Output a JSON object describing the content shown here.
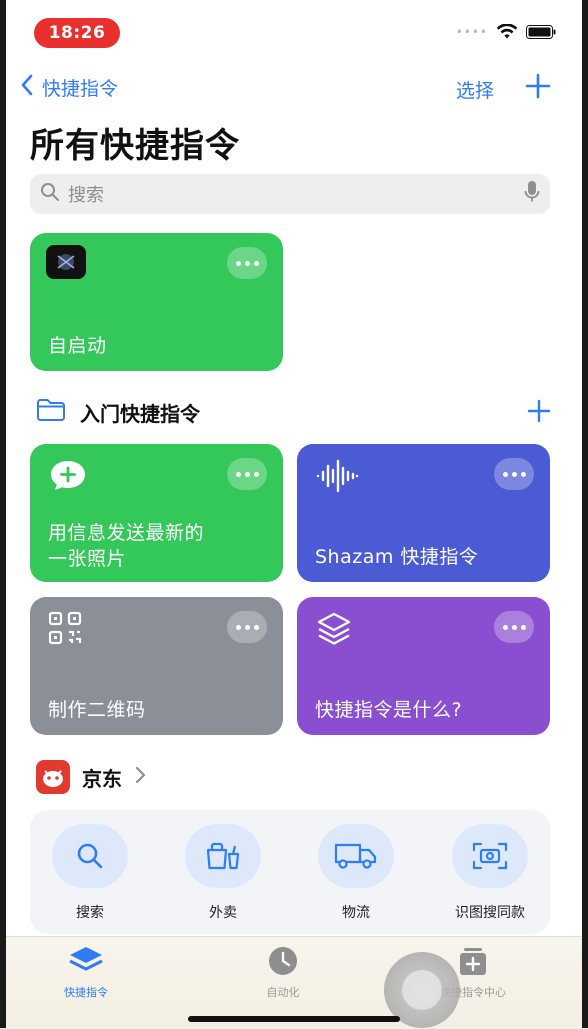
{
  "status": {
    "time": "18:26"
  },
  "nav": {
    "back_label": "快捷指令",
    "select_label": "选择"
  },
  "page": {
    "title": "所有快捷指令"
  },
  "search": {
    "placeholder": "搜索"
  },
  "shortcuts": {
    "top": {
      "label": "自启动"
    },
    "section_title": "入门快捷指令",
    "cards": [
      {
        "label": "用信息发送最新的\n一张照片",
        "icon": "message-plus-icon",
        "color": "#34c759"
      },
      {
        "label": "Shazam 快捷指令",
        "icon": "waveform-icon",
        "color": "#4a5bd3"
      },
      {
        "label": "制作二维码",
        "icon": "qr-code-icon",
        "color": "#8a8f98"
      },
      {
        "label": "快捷指令是什么?",
        "icon": "layers-icon",
        "color": "#8a4fd1"
      }
    ]
  },
  "jd": {
    "title": "京东",
    "items": [
      {
        "label": "搜索",
        "icon": "search-icon"
      },
      {
        "label": "外卖",
        "icon": "takeout-icon"
      },
      {
        "label": "物流",
        "icon": "truck-icon"
      },
      {
        "label": "识图搜同款",
        "icon": "camera-scan-icon"
      }
    ]
  },
  "tabbar": {
    "items": [
      {
        "label": "快捷指令",
        "icon": "stack-icon",
        "active": true
      },
      {
        "label": "自动化",
        "icon": "clock-icon",
        "active": false
      },
      {
        "label": "快捷指令中心",
        "icon": "gallery-icon",
        "active": false
      }
    ]
  },
  "colors": {
    "accent": "#2f7cf6",
    "status_red": "#e8312f"
  }
}
